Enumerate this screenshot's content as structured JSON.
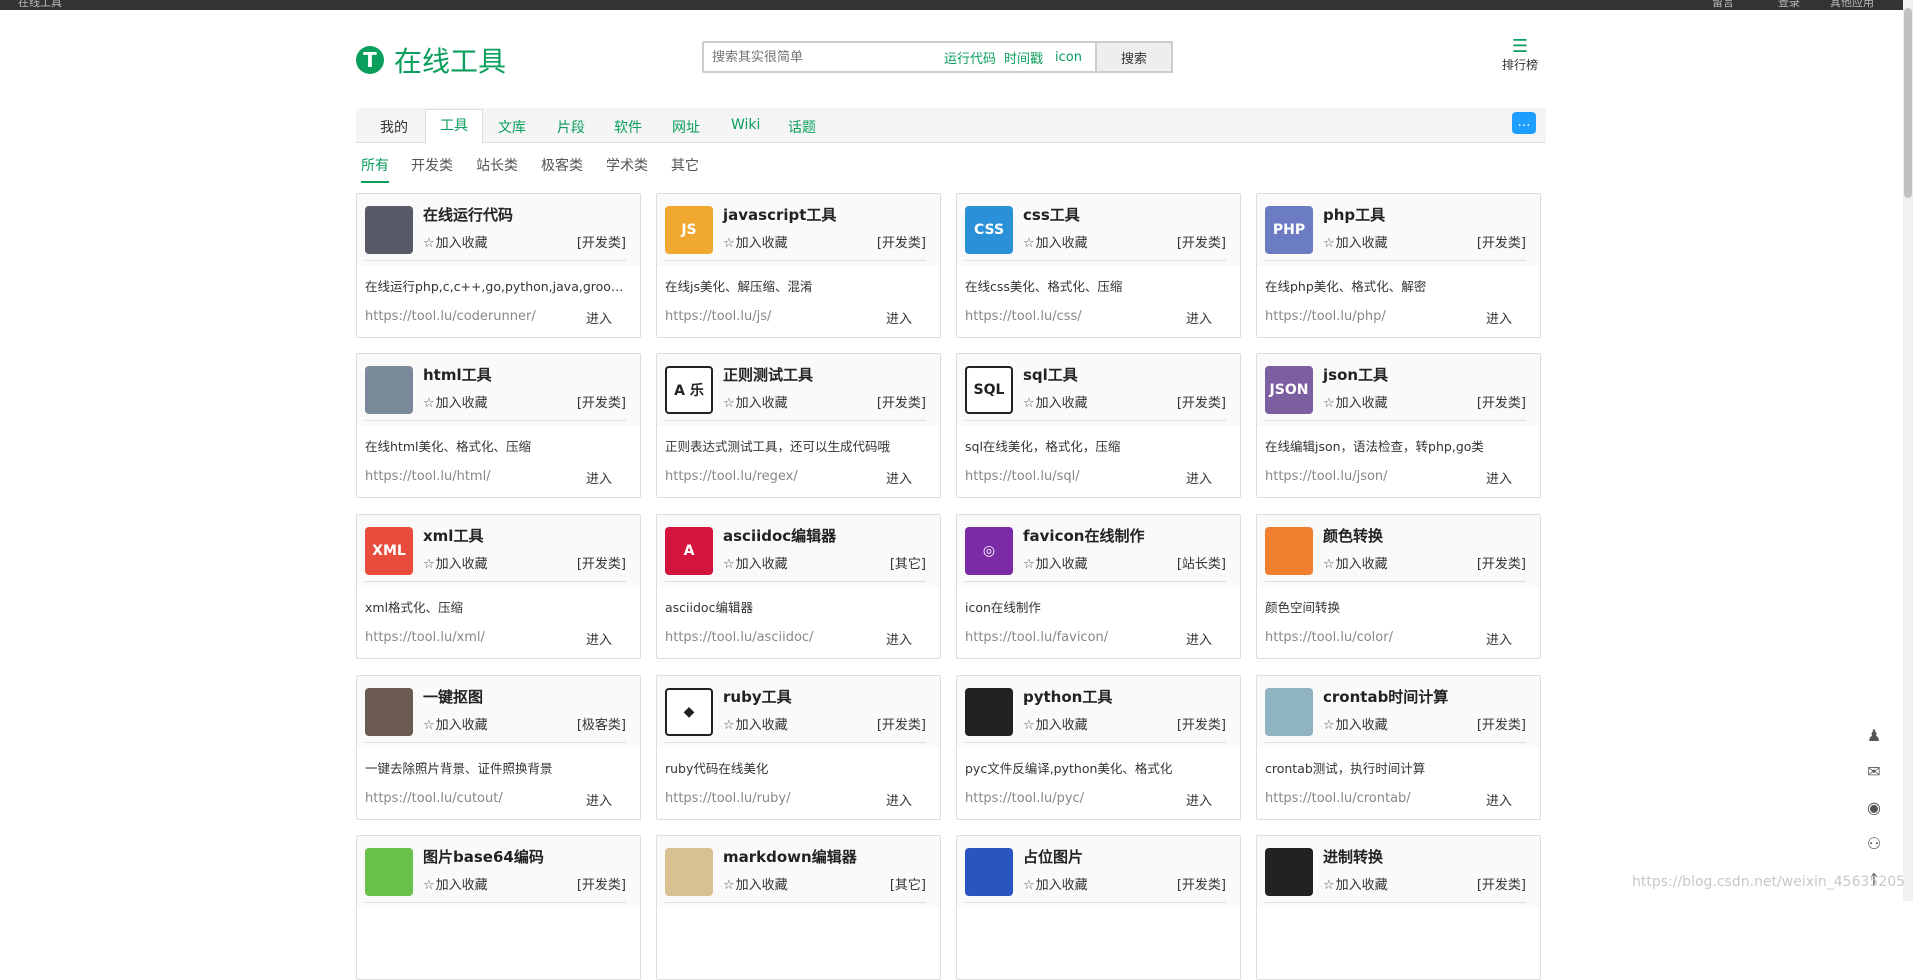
{
  "topbar": {
    "left": "在线工具",
    "right": [
      "留言",
      "登录",
      "其他应用"
    ]
  },
  "logo": {
    "mark": "T",
    "text": "在线工具"
  },
  "search": {
    "placeholder": "搜索其实很简单",
    "hot": [
      "运行代码",
      "时间戳",
      "icon"
    ],
    "button": "搜索"
  },
  "rank": {
    "label": "排行榜"
  },
  "nav": {
    "tabs": [
      "我的",
      "工具",
      "文库",
      "片段",
      "软件",
      "网址",
      "Wiki",
      "话题"
    ]
  },
  "subnav": {
    "items": [
      "所有",
      "开发类",
      "站长类",
      "极客类",
      "学术类",
      "其它"
    ]
  },
  "fav_label": "加入收藏",
  "enter_label": "进入",
  "cards": [
    {
      "title": "在线运行代码",
      "cat": "[开发类]",
      "desc": "在线运行php,c,c++,go,python,java,groovy...",
      "url": "https://tool.lu/coderunner/",
      "icon": "code-runner-icon",
      "icon_text": "",
      "color": "#555a66"
    },
    {
      "title": "javascript工具",
      "cat": "[开发类]",
      "desc": "在线js美化、解压缩、混淆",
      "url": "https://tool.lu/js/",
      "icon": "js-file-icon",
      "icon_text": "JS",
      "color": "#f0a830"
    },
    {
      "title": "css工具",
      "cat": "[开发类]",
      "desc": "在线css美化、格式化、压缩",
      "url": "https://tool.lu/css/",
      "icon": "css-file-icon",
      "icon_text": "CSS",
      "color": "#2a90d8"
    },
    {
      "title": "php工具",
      "cat": "[开发类]",
      "desc": "在线php美化、格式化、解密",
      "url": "https://tool.lu/php/",
      "icon": "php-monitor-icon",
      "icon_text": "PHP",
      "color": "#6b7cc2"
    },
    {
      "title": "html工具",
      "cat": "[开发类]",
      "desc": "在线html美化、格式化、压缩",
      "url": "https://tool.lu/html/",
      "icon": "html-editor-icon",
      "icon_text": "",
      "color": "#7a8a9a"
    },
    {
      "title": "正则测试工具",
      "cat": "[开发类]",
      "desc": "正则表达式测试工具，还可以生成代码哦",
      "url": "https://tool.lu/regex/",
      "icon": "regex-icon",
      "icon_text": "A 乐",
      "color": "#ffffff"
    },
    {
      "title": "sql工具",
      "cat": "[开发类]",
      "desc": "sql在线美化，格式化，压缩",
      "url": "https://tool.lu/sql/",
      "icon": "sql-icon",
      "icon_text": "SQL",
      "color": "#ffffff"
    },
    {
      "title": "json工具",
      "cat": "[开发类]",
      "desc": "在线编辑json，语法检查，转php,go类",
      "url": "https://tool.lu/json/",
      "icon": "json-file-icon",
      "icon_text": "JSON",
      "color": "#7b5fa0"
    },
    {
      "title": "xml工具",
      "cat": "[开发类]",
      "desc": "xml格式化、压缩",
      "url": "https://tool.lu/xml/",
      "icon": "xml-file-icon",
      "icon_text": "XML",
      "color": "#e84c3d"
    },
    {
      "title": "asciidoc编辑器",
      "cat": "[其它]",
      "desc": "asciidoc编辑器",
      "url": "https://tool.lu/asciidoc/",
      "icon": "asciidoc-icon",
      "icon_text": "A",
      "color": "#d3153e"
    },
    {
      "title": "favicon在线制作",
      "cat": "[站长类]",
      "desc": "icon在线制作",
      "url": "https://tool.lu/favicon/",
      "icon": "instagram-camera-icon",
      "icon_text": "◎",
      "color": "#7b2ba6"
    },
    {
      "title": "颜色转换",
      "cat": "[开发类]",
      "desc": "颜色空间转换",
      "url": "https://tool.lu/color/",
      "icon": "color-palette-icon",
      "icon_text": "",
      "color": "#f08030"
    },
    {
      "title": "一键抠图",
      "cat": "[极客类]",
      "desc": "一键去除照片背景、证件照换背景",
      "url": "https://tool.lu/cutout/",
      "icon": "portrait-photo-icon",
      "icon_text": "",
      "color": "#6a5a50"
    },
    {
      "title": "ruby工具",
      "cat": "[开发类]",
      "desc": "ruby代码在线美化",
      "url": "https://tool.lu/ruby/",
      "icon": "ruby-gem-icon",
      "icon_text": "◆",
      "color": "#ffffff"
    },
    {
      "title": "python工具",
      "cat": "[开发类]",
      "desc": "pyc文件反编译,python美化、格式化",
      "url": "https://tool.lu/pyc/",
      "icon": "python-logo-icon",
      "icon_text": "",
      "color": "#222222"
    },
    {
      "title": "crontab时间计算",
      "cat": "[开发类]",
      "desc": "crontab测试，执行时间计算",
      "url": "https://tool.lu/crontab/",
      "icon": "crontab-map-icon",
      "icon_text": "",
      "color": "#8fb3c0"
    },
    {
      "title": "图片base64编码",
      "cat": "[开发类]",
      "desc": "",
      "url": "",
      "icon": "base64-stack-icon",
      "icon_text": "",
      "color": "#6ac24a"
    },
    {
      "title": "markdown编辑器",
      "cat": "[其它]",
      "desc": "",
      "url": "",
      "icon": "notepad-icon",
      "icon_text": "",
      "color": "#d8c090"
    },
    {
      "title": "占位图片",
      "cat": "[开发类]",
      "desc": "",
      "url": "",
      "icon": "placeholder-image-icon",
      "icon_text": "",
      "color": "#2a55c0"
    },
    {
      "title": "进制转换",
      "cat": "[开发类]",
      "desc": "",
      "url": "",
      "icon": "binary-gear-icon",
      "icon_text": "",
      "color": "#222222"
    }
  ],
  "side_icons": [
    "qq-icon",
    "wechat-icon",
    "weibo-icon",
    "github-icon",
    "back-to-top-icon"
  ],
  "watermark": "https://blog.csdn.net/weixin_45635205"
}
